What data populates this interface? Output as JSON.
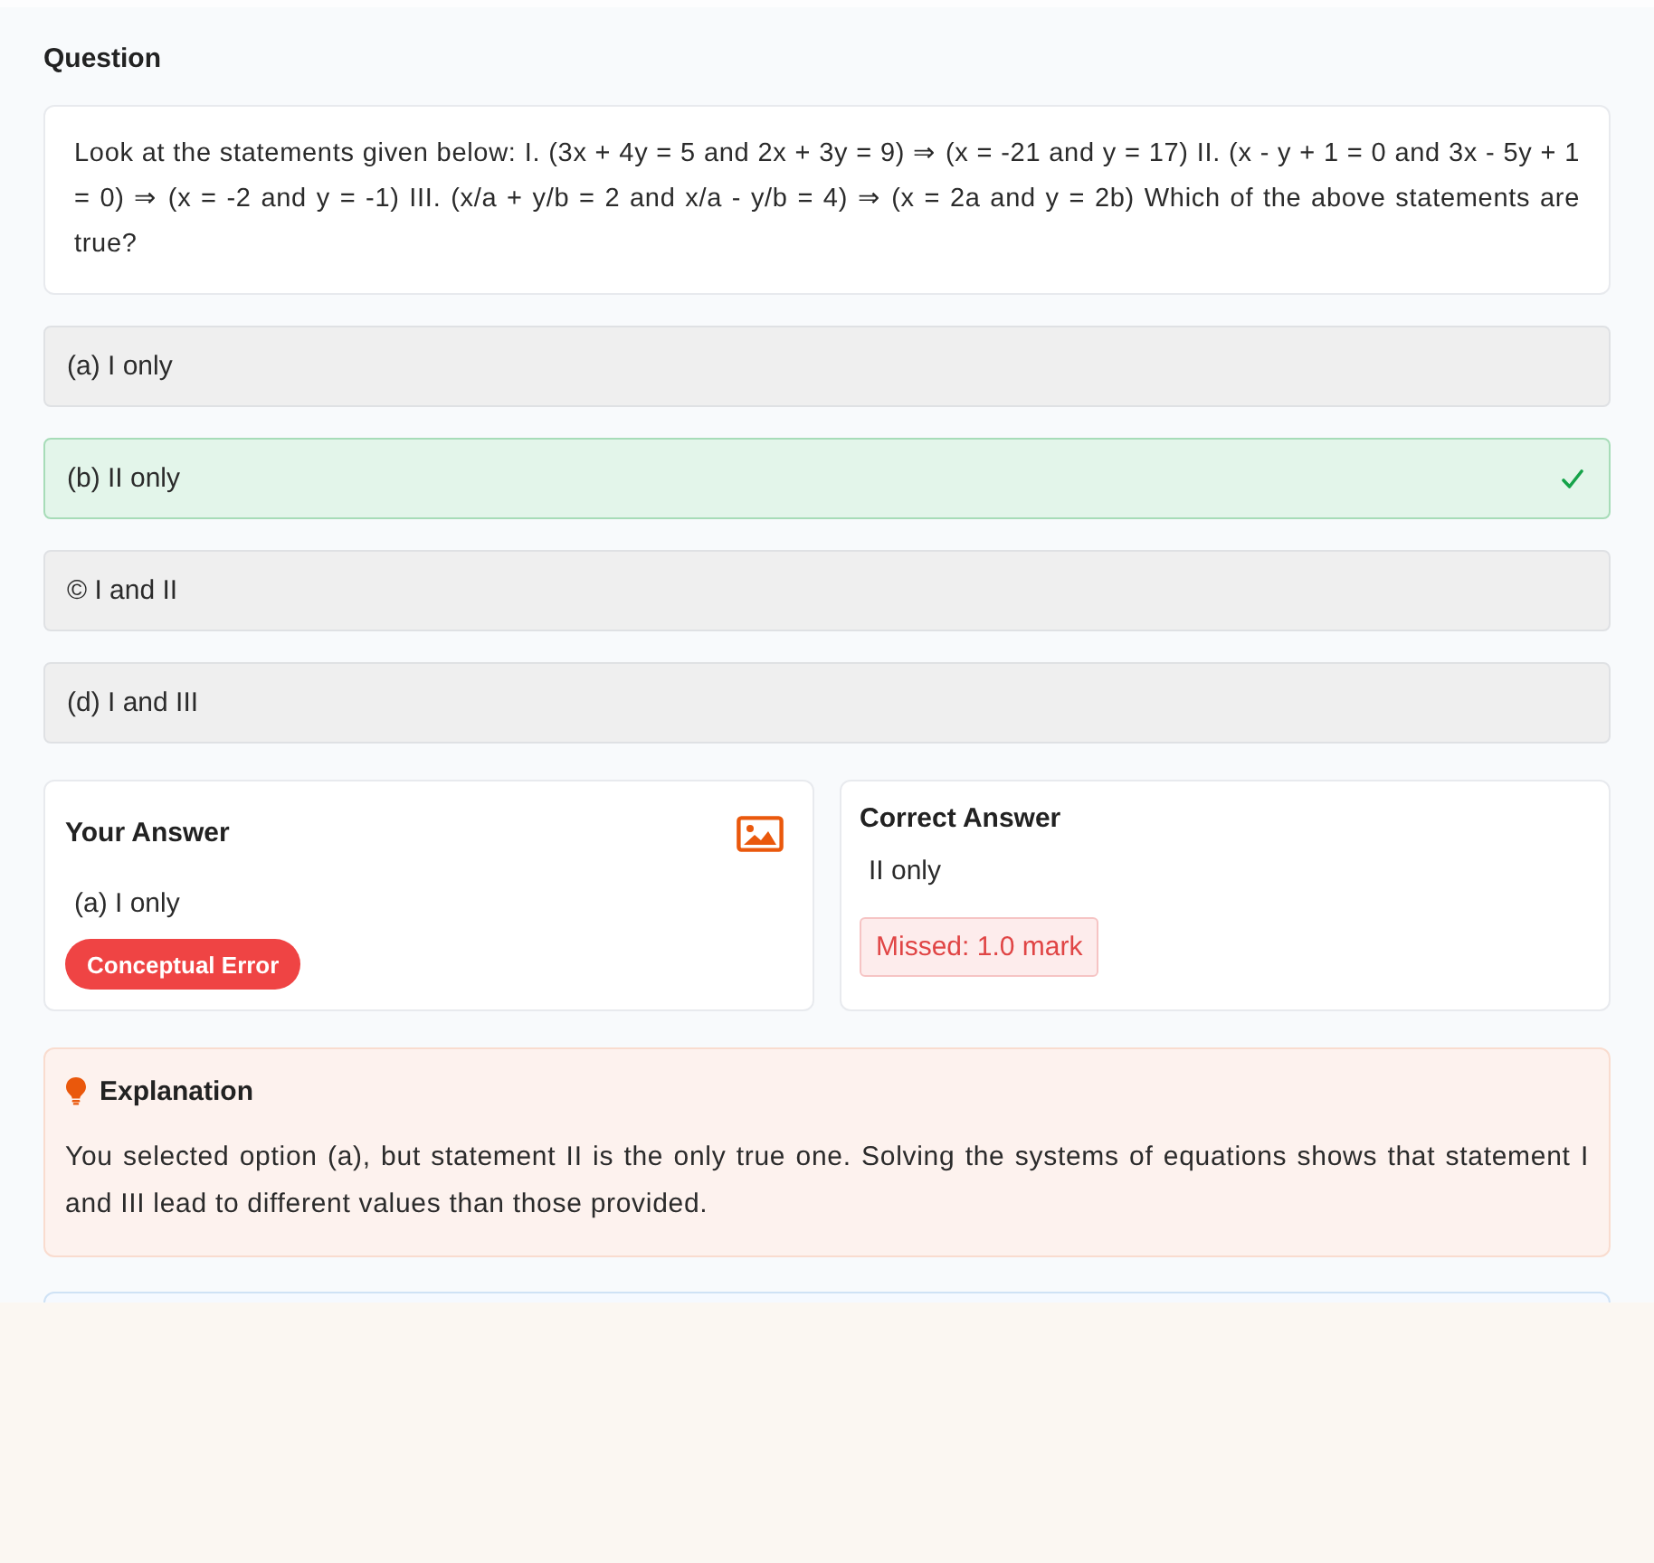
{
  "question": {
    "heading": "Question",
    "text": "Look at the statements given below: I. (3x + 4y = 5 and 2x + 3y = 9) ⇒ (x = -21 and y = 17) II. (x - y + 1 = 0 and 3x - 5y + 1 = 0) ⇒ (x = -2 and y = -1) III. (x/a + y/b = 2 and x/a - y/b = 4) ⇒ (x = 2a and y = 2b) Which of the above statements are true?"
  },
  "options": [
    {
      "label": "(a) I only",
      "correct": false
    },
    {
      "label": "(b) II only",
      "correct": true
    },
    {
      "label": "© I and II",
      "correct": false
    },
    {
      "label": "(d) I and III",
      "correct": false
    }
  ],
  "your_answer": {
    "title": "Your Answer",
    "value": "(a) I only",
    "error_tag": "Conceptual Error"
  },
  "correct_answer": {
    "title": "Correct Answer",
    "value": "II only",
    "missed": "Missed: 1.0 mark"
  },
  "explanation": {
    "title": "Explanation",
    "text": "You selected option (a), but statement II is the only true one. Solving the systems of equations shows that statement I and III lead to different values than those provided."
  }
}
